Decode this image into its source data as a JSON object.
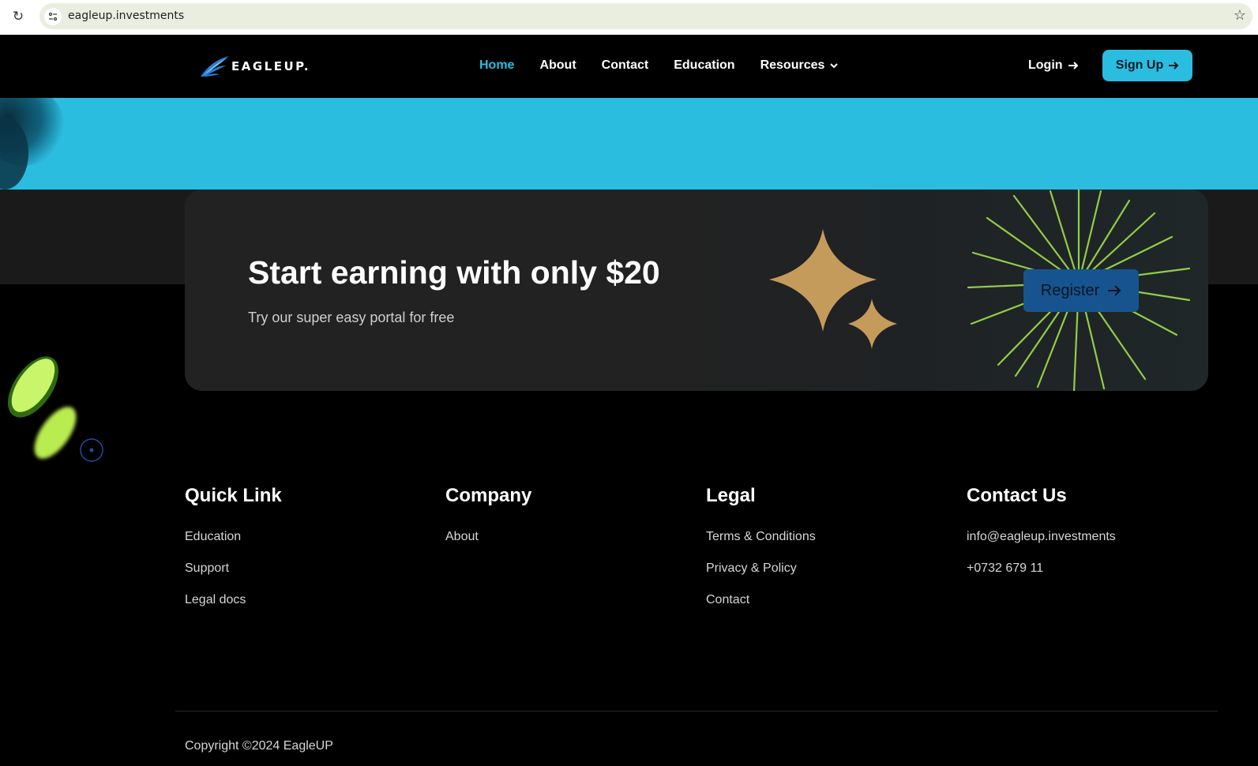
{
  "browser": {
    "url": "eagleup.investments",
    "reload_icon": "reload-icon",
    "site_info_icon": "site-info-icon",
    "bookmark_icon": "star-icon"
  },
  "header": {
    "logo_text": "EAGLEUP.",
    "nav": [
      {
        "label": "Home",
        "active": true
      },
      {
        "label": "About",
        "active": false
      },
      {
        "label": "Contact",
        "active": false
      },
      {
        "label": "Education",
        "active": false
      },
      {
        "label": "Resources",
        "active": false
      }
    ],
    "login_label": "Login",
    "signup_label": "Sign Up"
  },
  "cta": {
    "title": "Start earning with only $20",
    "subtitle": "Try our super easy portal for free",
    "register_label": "Register"
  },
  "footer": {
    "columns": [
      {
        "title": "Quick Link",
        "links": [
          "Education",
          "Support",
          "Legal docs"
        ]
      },
      {
        "title": "Company",
        "links": [
          "About"
        ]
      },
      {
        "title": "Legal",
        "links": [
          "Terms & Conditions",
          "Privacy & Policy",
          "Contact"
        ]
      },
      {
        "title": "Contact Us",
        "links": [
          "info@eagleup.investments",
          "+0732 679 11"
        ]
      }
    ],
    "copyright": "Copyright ©2024 EagleUP"
  },
  "colors": {
    "accent": "#2bbde0",
    "register_bg": "#17548f",
    "star_gold": "#c59b5c",
    "burst_green": "#9fe04a"
  }
}
